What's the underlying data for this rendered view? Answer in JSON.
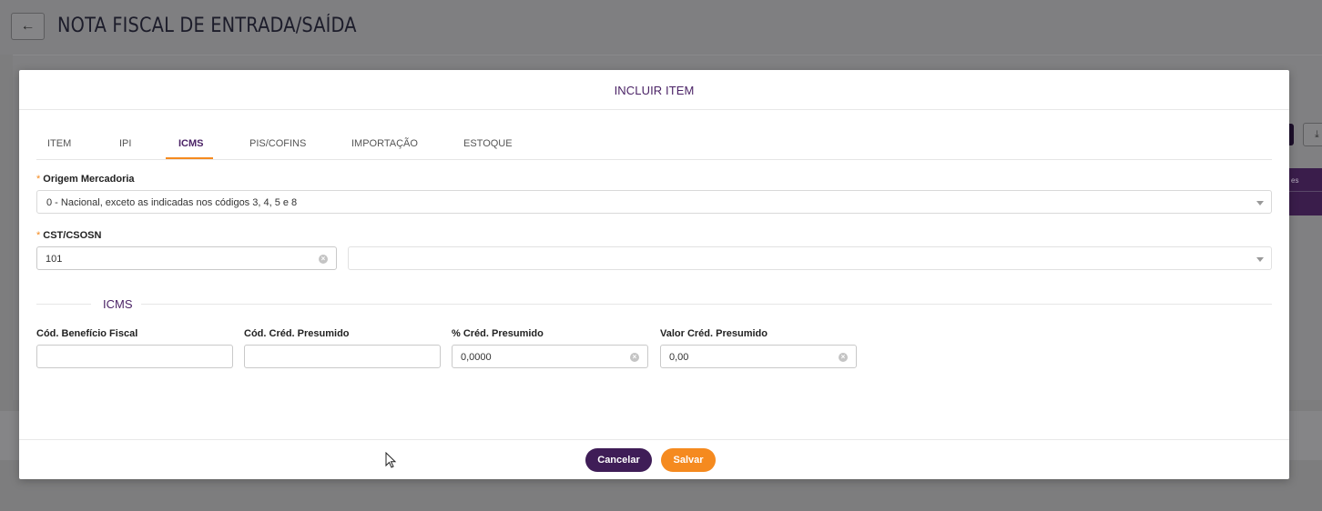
{
  "page": {
    "back_icon": "arrow-left-icon",
    "title": "NOTA FISCAL DE ENTRADA/SAÍDA"
  },
  "modal": {
    "title": "INCLUIR ITEM",
    "tabs": [
      {
        "label": "ITEM",
        "active": false
      },
      {
        "label": "IPI",
        "active": false
      },
      {
        "label": "ICMS",
        "active": true
      },
      {
        "label": "PIS/COFINS",
        "active": false
      },
      {
        "label": "IMPORTAÇÃO",
        "active": false
      },
      {
        "label": "ESTOQUE",
        "active": false
      }
    ],
    "origem": {
      "label": "Origem Mercadoria",
      "value": "0 - Nacional, exceto as indicadas nos códigos 3, 4, 5 e 8"
    },
    "cst": {
      "label": "CST/CSOSN",
      "value": "101",
      "description_value": ""
    },
    "section_title": "ICMS",
    "fields": {
      "cod_beneficio": {
        "label": "Cód. Benefício Fiscal",
        "value": ""
      },
      "cod_cred_presumido": {
        "label": "Cód. Créd. Presumido",
        "value": ""
      },
      "pct_cred_presumido": {
        "label": "% Créd. Presumido",
        "value": "0,0000"
      },
      "valor_cred_presumido": {
        "label": "Valor Créd. Presumido",
        "value": "0,00"
      }
    },
    "buttons": {
      "cancel": "Cancelar",
      "save": "Salvar"
    }
  },
  "colors": {
    "primary_purple": "#4b2366",
    "dark_purple_button": "#3f1d57",
    "accent_orange": "#f58a1f",
    "overlay": "#7d7d7e"
  }
}
